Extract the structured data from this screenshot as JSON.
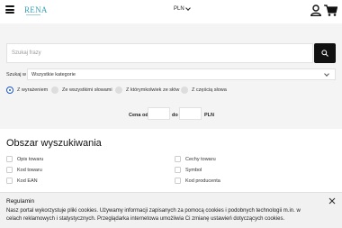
{
  "header": {
    "logo_text": "RENA",
    "currency": "PLN",
    "icons": {
      "menu": "hamburger-icon",
      "user": "user-icon",
      "cart": "cart-icon"
    }
  },
  "search": {
    "placeholder": "Szukaj frazy",
    "button_icon": "search-icon",
    "scope_label": "Szukaj w",
    "scope_value": "Wszystkie kategorie"
  },
  "match_options": [
    {
      "label": "Z wyrażeniem",
      "selected": true
    },
    {
      "label": "Ze wszystkimi słowami",
      "selected": false
    },
    {
      "label": "Z którymkolwiek ze słów",
      "selected": false
    },
    {
      "label": "Z częścią słowa",
      "selected": false
    }
  ],
  "price": {
    "from_label": "Cena od",
    "to_label": "do",
    "currency": "PLN"
  },
  "search_area": {
    "title": "Obszar wyszukiwania",
    "fields": [
      "Opis towaru",
      "Cechy towaru",
      "Kod towaru",
      "Symbol",
      "Kod EAN",
      "Kod producenta"
    ]
  },
  "cookie": {
    "title": "Regulamin",
    "text": "Nasz portal wykorzystuje pliki cookies. Używamy informacji zapisanych za pomocą cookies i podobnych technologii m.in. w celach reklamowych i statystycznych. Przeglądarka internetowa umożliwia Ci zmianę ustawień dotyczących cookies."
  },
  "colors": {
    "accent": "#1a56c8",
    "button": "#111111",
    "logo": "#3a9fb4",
    "panel": "#f4f4f4"
  }
}
